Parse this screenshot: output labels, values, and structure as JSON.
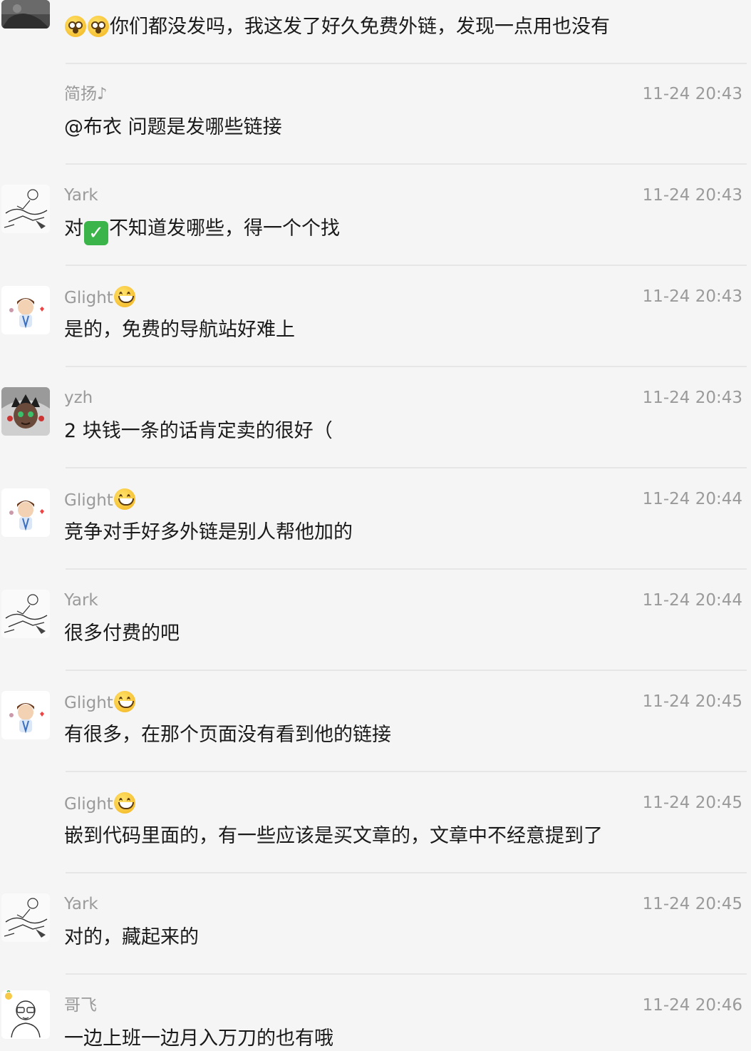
{
  "messages": [
    {
      "sender": "",
      "time": "",
      "avatar": "avatar-dark-photo",
      "text_parts": [
        "你们都没发吗，我这发了好久免费外链，发现一点用也没有"
      ],
      "emoji": [
        "dizzy-face",
        "dizzy-face"
      ]
    },
    {
      "sender": "简扬♪",
      "time": "11-24 20:43",
      "avatar": "",
      "text": "@布衣 问题是发哪些链接"
    },
    {
      "sender": "Yark",
      "time": "11-24 20:43",
      "avatar": "avatar-sketch",
      "text_before": "对",
      "text_after": "不知道发哪些，得一个个找",
      "inline_icon": "check-mark-button",
      "inline_icon_glyph": "✓"
    },
    {
      "sender": "Glight",
      "time": "11-24 20:43",
      "avatar": "avatar-cartoon-boy",
      "sender_emoji": "grinning-face",
      "text": "是的，免费的导航站好难上"
    },
    {
      "sender": "yzh",
      "time": "11-24 20:43",
      "avatar": "avatar-masked-face",
      "text": "2 块钱一条的话肯定卖的很好（"
    },
    {
      "sender": "Glight",
      "time": "11-24 20:44",
      "avatar": "avatar-cartoon-boy",
      "sender_emoji": "grinning-face",
      "text": "竞争对手好多外链是别人帮他加的"
    },
    {
      "sender": "Yark",
      "time": "11-24 20:44",
      "avatar": "avatar-sketch",
      "text": "很多付费的吧"
    },
    {
      "sender": "Glight",
      "time": "11-24 20:45",
      "avatar": "avatar-cartoon-boy",
      "sender_emoji": "grinning-face",
      "text": "有很多，在那个页面没有看到他的链接"
    },
    {
      "sender": "Glight",
      "time": "11-24 20:45",
      "avatar": "",
      "sender_emoji": "grinning-face",
      "text": "嵌到代码里面的，有一些应该是买文章的，文章中不经意提到了"
    },
    {
      "sender": "Yark",
      "time": "11-24 20:45",
      "avatar": "avatar-sketch",
      "text": "对的，藏起来的"
    },
    {
      "sender": "哥飞",
      "time": "11-24 20:46",
      "avatar": "avatar-glasses-man",
      "text": "一边上班一边月入万刀的也有哦"
    }
  ]
}
